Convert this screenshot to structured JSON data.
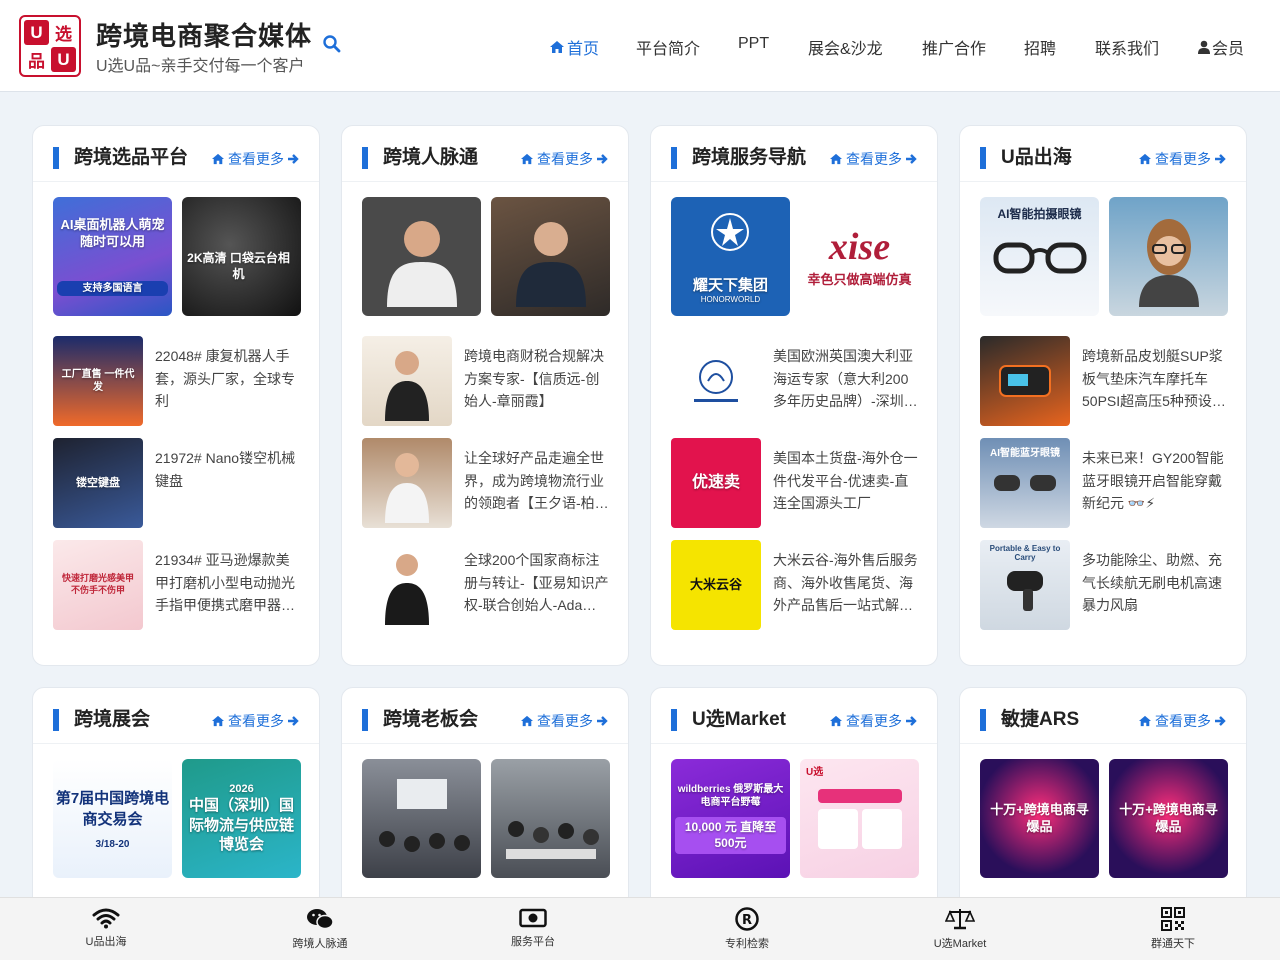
{
  "header": {
    "logo_chars": [
      "U",
      "选",
      "品",
      "U"
    ],
    "title": "跨境电商聚合媒体",
    "subtitle": "U选U品~亲手交付每一个客户",
    "nav": [
      {
        "label": "首页",
        "active": true,
        "icon": "home-icon"
      },
      {
        "label": "平台简介"
      },
      {
        "label": "PPT"
      },
      {
        "label": "展会&沙龙"
      },
      {
        "label": "推广合作"
      },
      {
        "label": "招聘"
      },
      {
        "label": "联系我们"
      },
      {
        "label": "会员",
        "icon": "user-icon"
      }
    ]
  },
  "more_label": "查看更多",
  "cards": [
    {
      "title": "跨境选品平台",
      "thumbs": [
        {
          "caption": "AI桌面机器人萌宠 随时可以用",
          "sub": "支持多国语言"
        },
        {
          "caption": "2K高清 口袋云台相机",
          "sub": ""
        }
      ],
      "items": [
        {
          "text": "22048# 康复机器人手套，源头厂家，全球专利",
          "caption": "工厂直售 一件代发"
        },
        {
          "text": "21972# Nano镂空机械键盘",
          "caption": "镂空键盘"
        },
        {
          "text": "21934# 亚马逊爆款美甲打磨机小型电动抛光手指甲便携式磨甲器…",
          "caption": "快速打磨光感美甲 不伤手不伤甲"
        }
      ]
    },
    {
      "title": "跨境人脉通",
      "thumbs": [
        {
          "caption": ""
        },
        {
          "caption": ""
        }
      ],
      "items": [
        {
          "text": "跨境电商财税合规解决方案专家-【信质远-创始人-章丽霞】"
        },
        {
          "text": "让全球好产品走遍全世界，成为跨境物流行业的领跑者【王夕语-柏…"
        },
        {
          "text": "全球200个国家商标注册与转让-【亚易知识产权-联合创始人-Ada…"
        }
      ]
    },
    {
      "title": "跨境服务导航",
      "thumbs": [
        {
          "caption": "耀天下集团",
          "sub": "HONORWORLD"
        },
        {
          "caption": "xise",
          "sub": "幸色只做高端仿真"
        }
      ],
      "items": [
        {
          "text": "美国欧洲英国澳大利亚海运专家（意大利200多年历史品牌）-深圳…"
        },
        {
          "text": "美国本土货盘-海外仓一件代发平台-优速卖-直连全国源头工厂",
          "caption": "优速卖"
        },
        {
          "text": "大米云谷-海外售后服务商、海外收售尾货、海外产品售后一站式解…",
          "caption": "大米云谷"
        }
      ]
    },
    {
      "title": "U品出海",
      "thumbs": [
        {
          "caption": "AI智能拍摄眼镜"
        },
        {
          "caption": ""
        }
      ],
      "items": [
        {
          "text": "跨境新品皮划艇SUP浆板气垫床汽车摩托车50PSI超高压5种预设…"
        },
        {
          "text": "未来已来！GY200智能蓝牙眼镜开启智能穿戴新纪元 👓⚡",
          "caption": "AI智能蓝牙眼镜"
        },
        {
          "text": "多功能除尘、助燃、充气长续航无刷电机高速暴力风扇",
          "caption": "Portable & Easy to Carry"
        }
      ]
    },
    {
      "title": "跨境展会",
      "thumbs": [
        {
          "caption": "第7届中国跨境电商交易会",
          "sub": "3/18-20"
        },
        {
          "caption": "中国（深圳）国际物流与供应链博览会",
          "sub": "2026"
        }
      ]
    },
    {
      "title": "跨境老板会",
      "thumbs": [
        {
          "caption": ""
        },
        {
          "caption": ""
        }
      ]
    },
    {
      "title": "U选Market",
      "thumbs": [
        {
          "caption": "wildberries 俄罗斯最大电商平台野莓",
          "sub": "10,000 元 直降至500元"
        },
        {
          "caption": "U选"
        }
      ]
    },
    {
      "title": "敏捷ARS",
      "thumbs": [
        {
          "caption": "十万+跨境电商寻爆品"
        },
        {
          "caption": "十万+跨境电商寻爆品"
        }
      ]
    }
  ],
  "bottom_bar": [
    {
      "label": "U品出海",
      "icon": "wifi-icon"
    },
    {
      "label": "跨境人脉通",
      "icon": "wechat-icon"
    },
    {
      "label": "服务平台",
      "icon": "money-icon"
    },
    {
      "label": "专利检索",
      "icon": "registered-icon"
    },
    {
      "label": "U选Market",
      "icon": "scale-icon"
    },
    {
      "label": "群通天下",
      "icon": "qrcode-icon"
    }
  ],
  "colors": {
    "accent": "#1e6fd9",
    "brand_red": "#c8102e",
    "page_bg": "#eef3f8"
  }
}
